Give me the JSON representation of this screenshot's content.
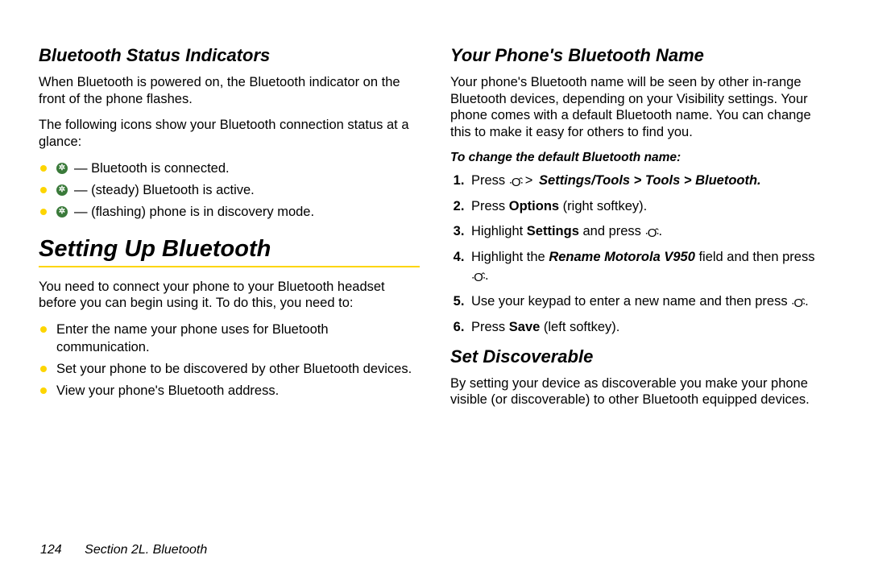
{
  "left": {
    "h_status": "Bluetooth Status Indicators",
    "p1": "When Bluetooth is powered on, the Bluetooth indicator on the front of the phone flashes.",
    "p2": "The following icons show your Bluetooth connection status at a glance:",
    "icons": [
      "— Bluetooth is connected.",
      "— (steady) Bluetooth is active.",
      "— (flashing) phone is in discovery mode."
    ],
    "h_setup": "Setting Up Bluetooth",
    "p3": "You need to connect your phone to your Bluetooth headset before you can begin using it. To do this, you need to:",
    "setup_items": [
      "Enter the name your phone uses for Bluetooth communication.",
      "Set your phone to be discovered by other Bluetooth devices.",
      "View your phone's Bluetooth address."
    ]
  },
  "right": {
    "h_name": "Your Phone's Bluetooth Name",
    "p1": "Your phone's Bluetooth name will be seen by other in-range Bluetooth devices, depending on your Visibility settings. Your phone comes with a default Bluetooth name. You can change this to make it easy for others to find you.",
    "lead": "To change the default Bluetooth name:",
    "step1_press": "Press ",
    "step1_menu": "Settings/Tools > Tools > Bluetooth.",
    "step2a": "Press ",
    "step2b": "Options",
    "step2c": " (right softkey).",
    "step3a": "Highlight ",
    "step3b": "Settings",
    "step3c": " and press ",
    "step4a": "Highlight the ",
    "step4b": "Rename Motorola V950",
    "step4c": " field and then press ",
    "step5a": "Use your keypad to enter a new name and then press ",
    "step6a": "Press ",
    "step6b": "Save",
    "step6c": " (left softkey).",
    "h_disc": "Set Discoverable",
    "p_disc": "By setting your device as discoverable you make your phone visible (or discoverable) to other Bluetooth equipped devices."
  },
  "footer": {
    "page": "124",
    "section": "Section 2L. Bluetooth"
  }
}
